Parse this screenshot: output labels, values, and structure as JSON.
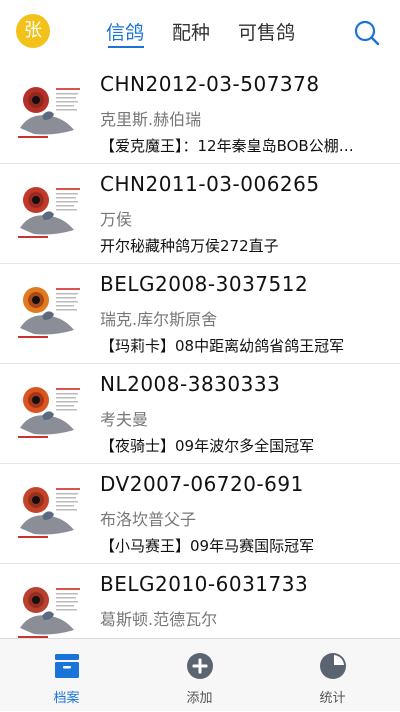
{
  "header": {
    "avatar_text": "张",
    "tabs": [
      {
        "label": "信鸽",
        "active": true
      },
      {
        "label": "配种",
        "active": false
      },
      {
        "label": "可售鸽",
        "active": false
      }
    ],
    "search_icon": "search-icon",
    "accent": "#1a73d9",
    "avatar_color": "#f2c21a"
  },
  "pigeons": [
    {
      "ring": "CHN2012-03-507378",
      "owner": "克里斯.赫伯瑞",
      "desc": "【爱克魔王】：12年秦皇岛BOB公棚…",
      "eye_color": "#b4312a"
    },
    {
      "ring": "CHN2011-03-006265",
      "owner": "万侯",
      "desc": "开尔秘藏种鸽万侯272直子",
      "eye_color": "#c0392b"
    },
    {
      "ring": "BELG2008-3037512",
      "owner": "瑞克.库尔斯原舍",
      "desc": "【玛莉卡】08中距离幼鸽省鸽王冠军",
      "eye_color": "#e07a1f"
    },
    {
      "ring": "NL2008-3830333",
      "owner": "考夫曼",
      "desc": "【夜骑士】09年波尔多全国冠军",
      "eye_color": "#d9541e"
    },
    {
      "ring": "DV2007-06720-691",
      "owner": "布洛坎普父子",
      "desc": "【小马赛王】09年马赛国际冠军",
      "eye_color": "#c2452a"
    },
    {
      "ring": "BELG2010-6031733",
      "owner": "葛斯顿.范德瓦尔",
      "desc": "",
      "eye_color": "#b8402e"
    }
  ],
  "tabbar": {
    "items": [
      {
        "label": "档案",
        "icon": "archive-icon",
        "active": true
      },
      {
        "label": "添加",
        "icon": "add-circle-icon",
        "active": false
      },
      {
        "label": "统计",
        "icon": "pie-chart-icon",
        "active": false
      }
    ]
  }
}
